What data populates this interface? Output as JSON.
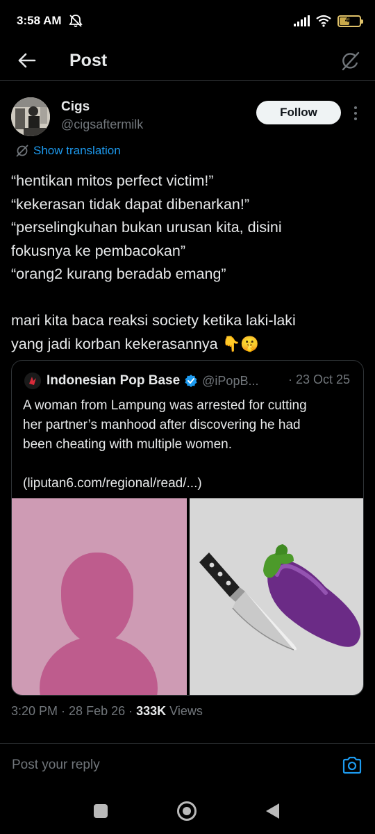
{
  "status_bar": {
    "time": "3:58 AM",
    "battery_level": "46",
    "icons": [
      "mute-icon",
      "signal-icon",
      "wifi-icon",
      "battery-icon"
    ]
  },
  "header": {
    "title": "Post",
    "icons": [
      "back-arrow-icon",
      "grok-icon"
    ]
  },
  "author": {
    "name": "Cigs",
    "handle": "@cigsaftermilk",
    "follow_label": "Follow"
  },
  "translation": {
    "label": "Show translation",
    "icon": "translate-icon"
  },
  "tweet": {
    "lines": [
      "“hentikan mitos perfect victim!”",
      "“kekerasan tidak dapat dibenarkan!”",
      "“perselingkuhan bukan urusan kita, disini",
      "fokusnya ke pembacokan”",
      "“orang2 kurang beradab emang”",
      "mari kita baca reaksi society ketika laki-laki",
      "yang jadi korban kekerasannya 👇🤫"
    ]
  },
  "quote": {
    "name": "Indonesian Pop Base",
    "handle": "@iPopB...",
    "date": "· 23 Oct 25",
    "text_lines": [
      "A woman from Lampung was arrested for cutting",
      "her partner’s manhood after discovering he had",
      "been cheating with multiple women.",
      "(liputan6.com/regional/read/...)"
    ],
    "media": [
      "profile-placeholder-image",
      "knife-eggplant-emoji-image"
    ]
  },
  "meta": {
    "time": "3:20 PM",
    "date": "28 Feb 26",
    "views_count": "333K",
    "views_label": "Views"
  },
  "reply": {
    "placeholder": "Post your reply",
    "icon": "camera-icon"
  },
  "colors": {
    "background": "#000000",
    "text": "#e7e9ea",
    "muted": "#71767b",
    "accent": "#1d9bf0",
    "border": "#2f3336",
    "placeholder_pink": "#ce9bb4"
  }
}
